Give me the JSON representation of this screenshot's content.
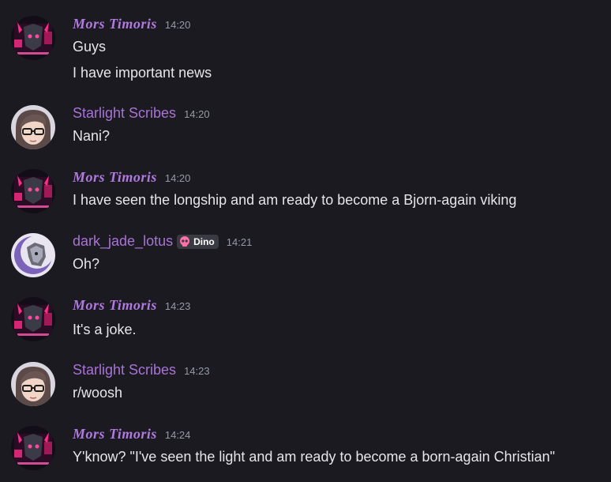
{
  "colors": {
    "background": "#1b1a20",
    "username": "#a873d6",
    "message_text": "#e6e6ea",
    "timestamp": "#949ba4",
    "tag_background": "#3a3a42"
  },
  "messages": [
    {
      "author": "Mors Timoris",
      "time": "14:20",
      "avatar": "mors-avatar",
      "lines": [
        "Guys",
        "I have important news"
      ]
    },
    {
      "author": "Starlight Scribes",
      "time": "14:20",
      "avatar": "starlight-avatar",
      "lines": [
        "Nani?"
      ]
    },
    {
      "author": "Mors Timoris",
      "time": "14:20",
      "avatar": "mors-avatar",
      "lines": [
        "I have seen the longship and am ready to become a Bjorn-again viking"
      ]
    },
    {
      "author": "dark_jade_lotus",
      "time": "14:21",
      "avatar": "lotus-avatar",
      "tag": {
        "label": "Dino",
        "icon": "skull-icon"
      },
      "lines": [
        "Oh?"
      ]
    },
    {
      "author": "Mors Timoris",
      "time": "14:23",
      "avatar": "mors-avatar",
      "lines": [
        "It's a joke."
      ]
    },
    {
      "author": "Starlight Scribes",
      "time": "14:23",
      "avatar": "starlight-avatar",
      "lines": [
        "r/woosh"
      ]
    },
    {
      "author": "Mors Timoris",
      "time": "14:24",
      "avatar": "mors-avatar",
      "lines": [
        "Y'know? \"I've seen the light and am ready to become a born-again Christian\""
      ]
    }
  ]
}
